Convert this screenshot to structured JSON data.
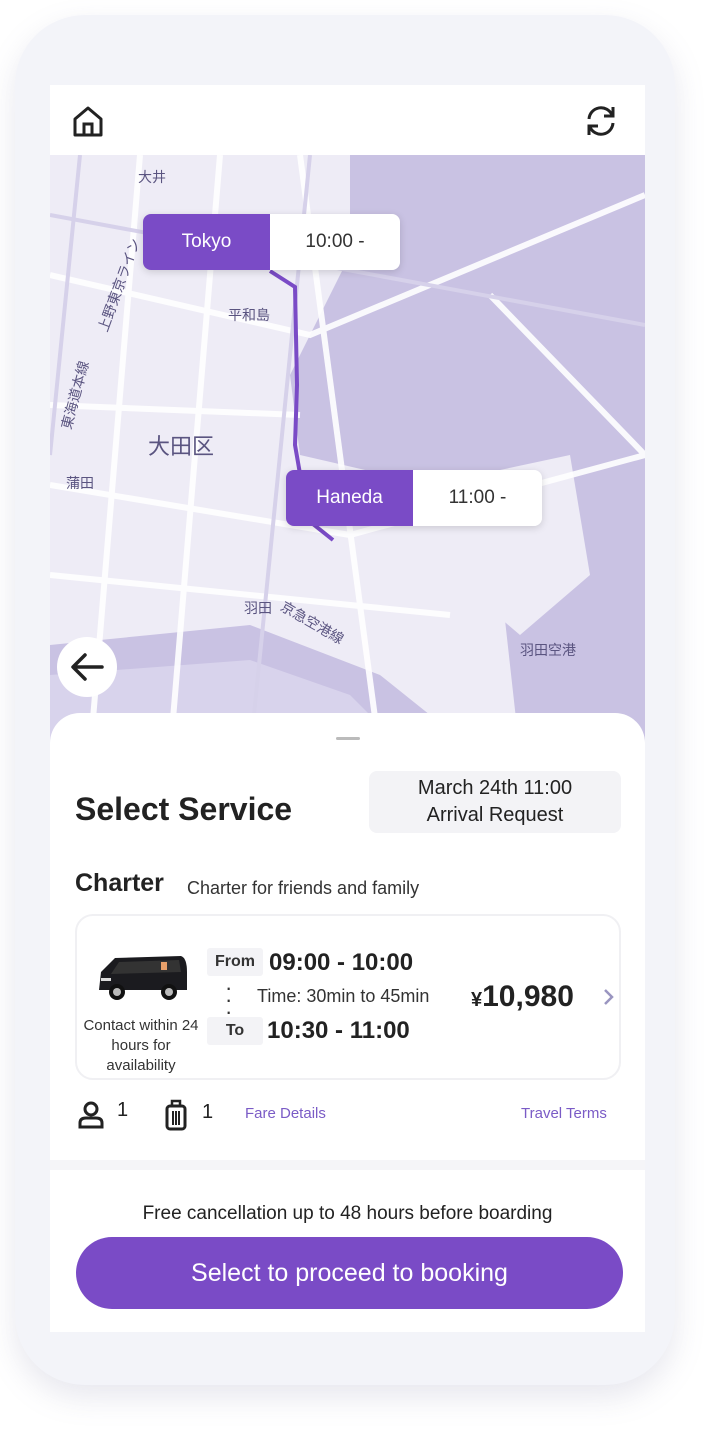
{
  "header": {
    "home_icon": "home-icon",
    "refresh_icon": "refresh-icon"
  },
  "map": {
    "origin": {
      "name": "Tokyo",
      "time": "10:00 -"
    },
    "destination": {
      "name": "Haneda",
      "time": "11:00 -"
    },
    "labels": [
      "大井",
      "平和島",
      "大田区",
      "蒲田",
      "羽田",
      "京急空港線",
      "羽田空港",
      "東海道本線",
      "上野東京ライン"
    ],
    "route_color": "#7a4bc6"
  },
  "sheet": {
    "title": "Select Service",
    "date": "March 24th 11:00",
    "request": "Arrival Request",
    "category": "Charter",
    "category_desc": "Charter for friends and family",
    "service": {
      "availability": "Contact within 24 hours for availability",
      "from_label": "From",
      "from_time": "09:00 - 10:00",
      "duration": "Time: 30min to 45min",
      "to_label": "To",
      "to_time": "10:30 - 11:00",
      "currency": "¥",
      "price": "10,980"
    },
    "passengers": "1",
    "luggage": "1",
    "fare_details": "Fare Details",
    "travel_terms": "Travel Terms"
  },
  "footer": {
    "notice": "Free cancellation up to 48 hours before boarding",
    "cta": "Select to proceed to booking"
  },
  "colors": {
    "accent": "#7a4bc6",
    "map_water": "#c9c2e3",
    "map_land": "#eeecf6"
  }
}
